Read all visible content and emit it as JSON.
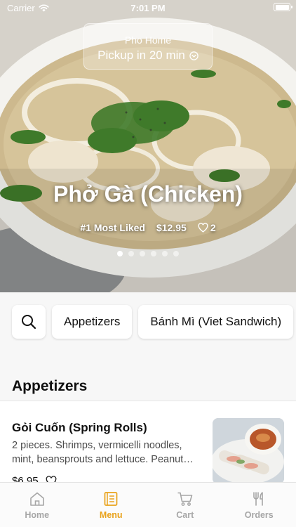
{
  "status_bar": {
    "carrier": "Carrier",
    "time": "7:01 PM"
  },
  "location": {
    "store_name": "Pho Home",
    "pickup_text": "Pickup in 20 min"
  },
  "featured": {
    "title": "Phở Gà (Chicken)",
    "badge": "#1 Most Liked",
    "price": "$12.95",
    "likes": "2",
    "slides_total": 6,
    "active_slide": 1
  },
  "categories": [
    {
      "label": "Appetizers"
    },
    {
      "label": "Bánh Mì (Viet Sandwich)"
    }
  ],
  "section": {
    "title": "Appetizers",
    "items": [
      {
        "name": "Gỏi Cuốn (Spring Rolls)",
        "description": "2 pieces. Shrimps, vermicelli noodles, mint, beansprouts and lettuce. Peanut…",
        "price": "$6.95"
      }
    ]
  },
  "tabbar": {
    "tabs": [
      {
        "label": "Home",
        "icon": "home-icon"
      },
      {
        "label": "Menu",
        "icon": "menu-icon"
      },
      {
        "label": "Cart",
        "icon": "cart-icon"
      },
      {
        "label": "Orders",
        "icon": "utensils-icon"
      }
    ],
    "active_color": "#e9a21a",
    "inactive_color": "#a6a6a6"
  }
}
